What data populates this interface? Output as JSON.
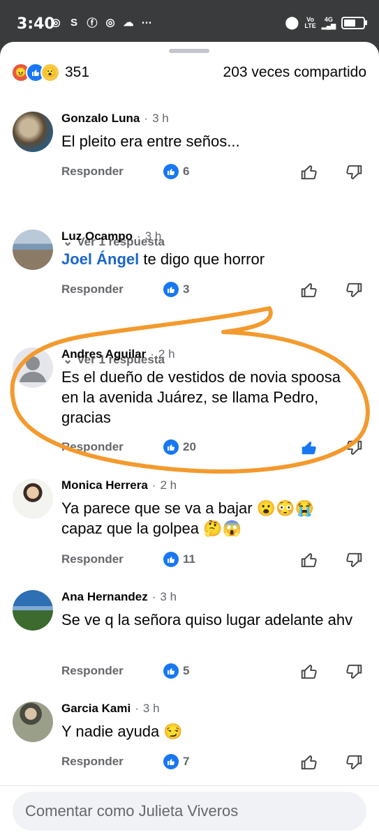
{
  "status": {
    "time": "3:40",
    "network_top": "Vo",
    "network_bottom": "LTE",
    "signal_label": "4G",
    "battery_level": 0.6
  },
  "header": {
    "reactions": [
      "angry-reaction",
      "like-reaction",
      "wow-reaction"
    ],
    "reaction_count": "351",
    "shares": "203 veces compartido"
  },
  "comments": [
    {
      "name": "Gonzalo Luna",
      "time": "3 h",
      "text": "El pleito era entre seños...",
      "reply": "Responder",
      "likes": "6",
      "view_replies": "Ver 1 respuesta"
    },
    {
      "name": "Luz Ocampo",
      "time": "3 h",
      "mention": "Joel Ángel",
      "text": " te digo que horror",
      "reply": "Responder",
      "likes": "3",
      "view_replies": "Ver 1 respuesta"
    },
    {
      "name": "Andres Aguilar",
      "time": "2 h",
      "text": "Es el dueño de vestidos de novia spoosa en la avenida Juárez, se llama Pedro, gracias",
      "reply": "Responder",
      "likes": "20",
      "liked": true
    },
    {
      "name": "Monica Herrera",
      "time": "2 h",
      "text": "Ya parece que se va a bajar 😮😳😭 capaz que la golpea 🤔😱",
      "reply": "Responder",
      "likes": "11"
    },
    {
      "name": "Ana Hernandez",
      "time": "3 h",
      "text": "Se ve q la señora quiso lugar adelante ahv",
      "reply": "Responder",
      "likes": "5"
    },
    {
      "name": "Garcia Kami",
      "time": "3 h",
      "text": "Y nadie ayuda 😏",
      "reply": "Responder",
      "likes": "7"
    }
  ],
  "composer": {
    "placeholder": "Comentar como Julieta Viveros"
  },
  "colors": {
    "accent": "#1877f2",
    "annotation": "#f39a2e",
    "mention": "#1b66c9"
  }
}
